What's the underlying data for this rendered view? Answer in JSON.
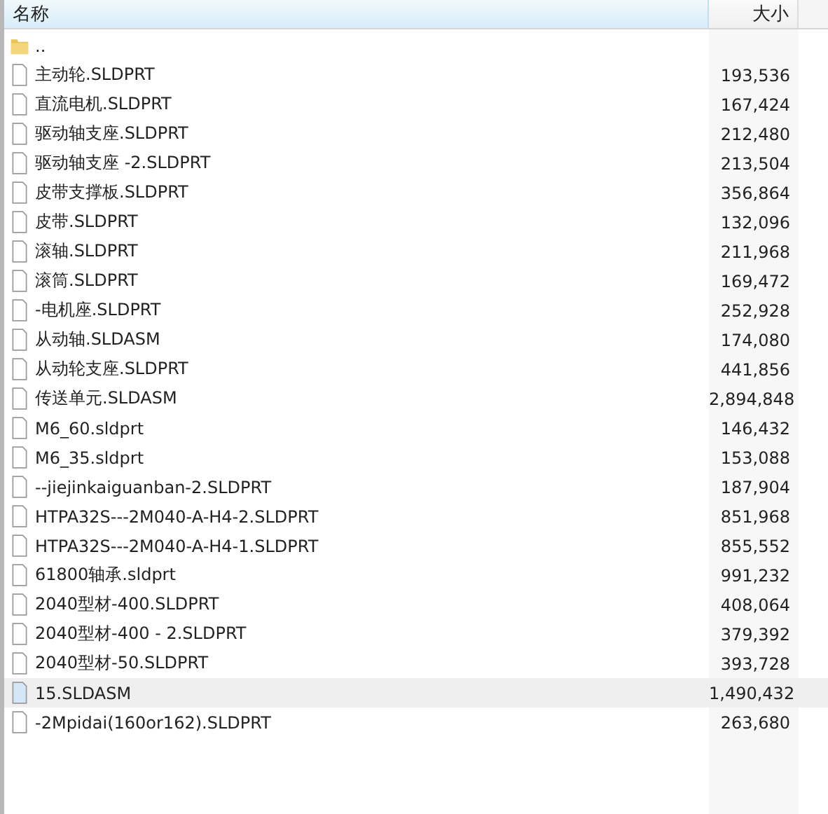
{
  "columns": [
    {
      "label": "名称"
    },
    {
      "label": "大小"
    }
  ],
  "rows": [
    {
      "kind": "folder",
      "name": "..",
      "size": "",
      "selected": false
    },
    {
      "kind": "file",
      "name": "主动轮.SLDPRT",
      "size": "193,536",
      "selected": false
    },
    {
      "kind": "file",
      "name": "直流电机.SLDPRT",
      "size": "167,424",
      "selected": false
    },
    {
      "kind": "file",
      "name": "驱动轴支座.SLDPRT",
      "size": "212,480",
      "selected": false
    },
    {
      "kind": "file",
      "name": "驱动轴支座 -2.SLDPRT",
      "size": "213,504",
      "selected": false
    },
    {
      "kind": "file",
      "name": "皮带支撑板.SLDPRT",
      "size": "356,864",
      "selected": false
    },
    {
      "kind": "file",
      "name": "皮带.SLDPRT",
      "size": "132,096",
      "selected": false
    },
    {
      "kind": "file",
      "name": "滚轴.SLDPRT",
      "size": "211,968",
      "selected": false
    },
    {
      "kind": "file",
      "name": "滚筒.SLDPRT",
      "size": "169,472",
      "selected": false
    },
    {
      "kind": "file",
      "name": "-电机座.SLDPRT",
      "size": "252,928",
      "selected": false
    },
    {
      "kind": "file",
      "name": "从动轴.SLDASM",
      "size": "174,080",
      "selected": false
    },
    {
      "kind": "file",
      "name": "从动轮支座.SLDPRT",
      "size": "441,856",
      "selected": false
    },
    {
      "kind": "file",
      "name": "传送单元.SLDASM",
      "size": "2,894,848",
      "selected": false
    },
    {
      "kind": "file",
      "name": "M6_60.sldprt",
      "size": "146,432",
      "selected": false
    },
    {
      "kind": "file",
      "name": "M6_35.sldprt",
      "size": "153,088",
      "selected": false
    },
    {
      "kind": "file",
      "name": "--jiejinkaiguanban-2.SLDPRT",
      "size": "187,904",
      "selected": false
    },
    {
      "kind": "file",
      "name": "HTPA32S---2M040-A-H4-2.SLDPRT",
      "size": "851,968",
      "selected": false
    },
    {
      "kind": "file",
      "name": "HTPA32S---2M040-A-H4-1.SLDPRT",
      "size": "855,552",
      "selected": false
    },
    {
      "kind": "file",
      "name": "61800轴承.sldprt",
      "size": "991,232",
      "selected": false
    },
    {
      "kind": "file",
      "name": "2040型材-400.SLDPRT",
      "size": "408,064",
      "selected": false
    },
    {
      "kind": "file",
      "name": "2040型材-400 - 2.SLDPRT",
      "size": "379,392",
      "selected": false
    },
    {
      "kind": "file",
      "name": "2040型材-50.SLDPRT",
      "size": "393,728",
      "selected": false
    },
    {
      "kind": "file",
      "name": "15.SLDASM",
      "size": "1,490,432",
      "selected": true
    },
    {
      "kind": "file",
      "name": "-2Mpidai(160or162).SLDPRT",
      "size": "263,680",
      "selected": false
    }
  ]
}
